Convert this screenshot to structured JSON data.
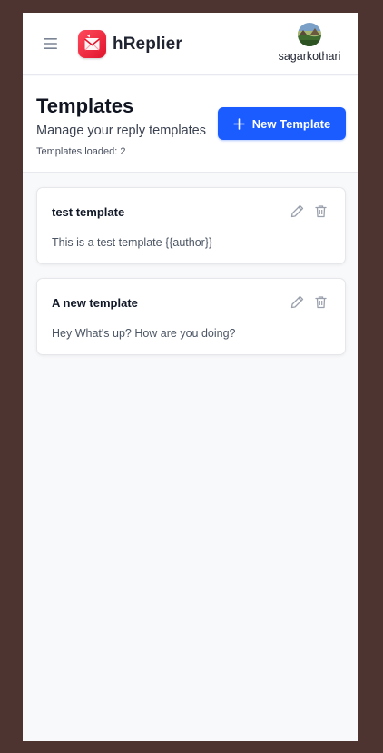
{
  "app": {
    "name": "hReplier",
    "logo_icon": "envelope-reply-icon",
    "brand_color": "#e8192f"
  },
  "user": {
    "username": "sagarkothari",
    "avatar_icon": "landscape-avatar"
  },
  "header": {
    "title": "Templates",
    "subtitle": "Manage your reply templates",
    "count_text": "Templates loaded: 2",
    "new_button_label": "New Template",
    "accent_color": "#1a5cff"
  },
  "templates": [
    {
      "title": "test template",
      "body": "This is a test template {{author}}"
    },
    {
      "title": "A new template",
      "body": "Hey What's up? How are you doing?"
    }
  ],
  "icons": {
    "menu": "hamburger-icon",
    "edit": "pencil-icon",
    "delete": "trash-icon",
    "add": "plus-icon"
  }
}
